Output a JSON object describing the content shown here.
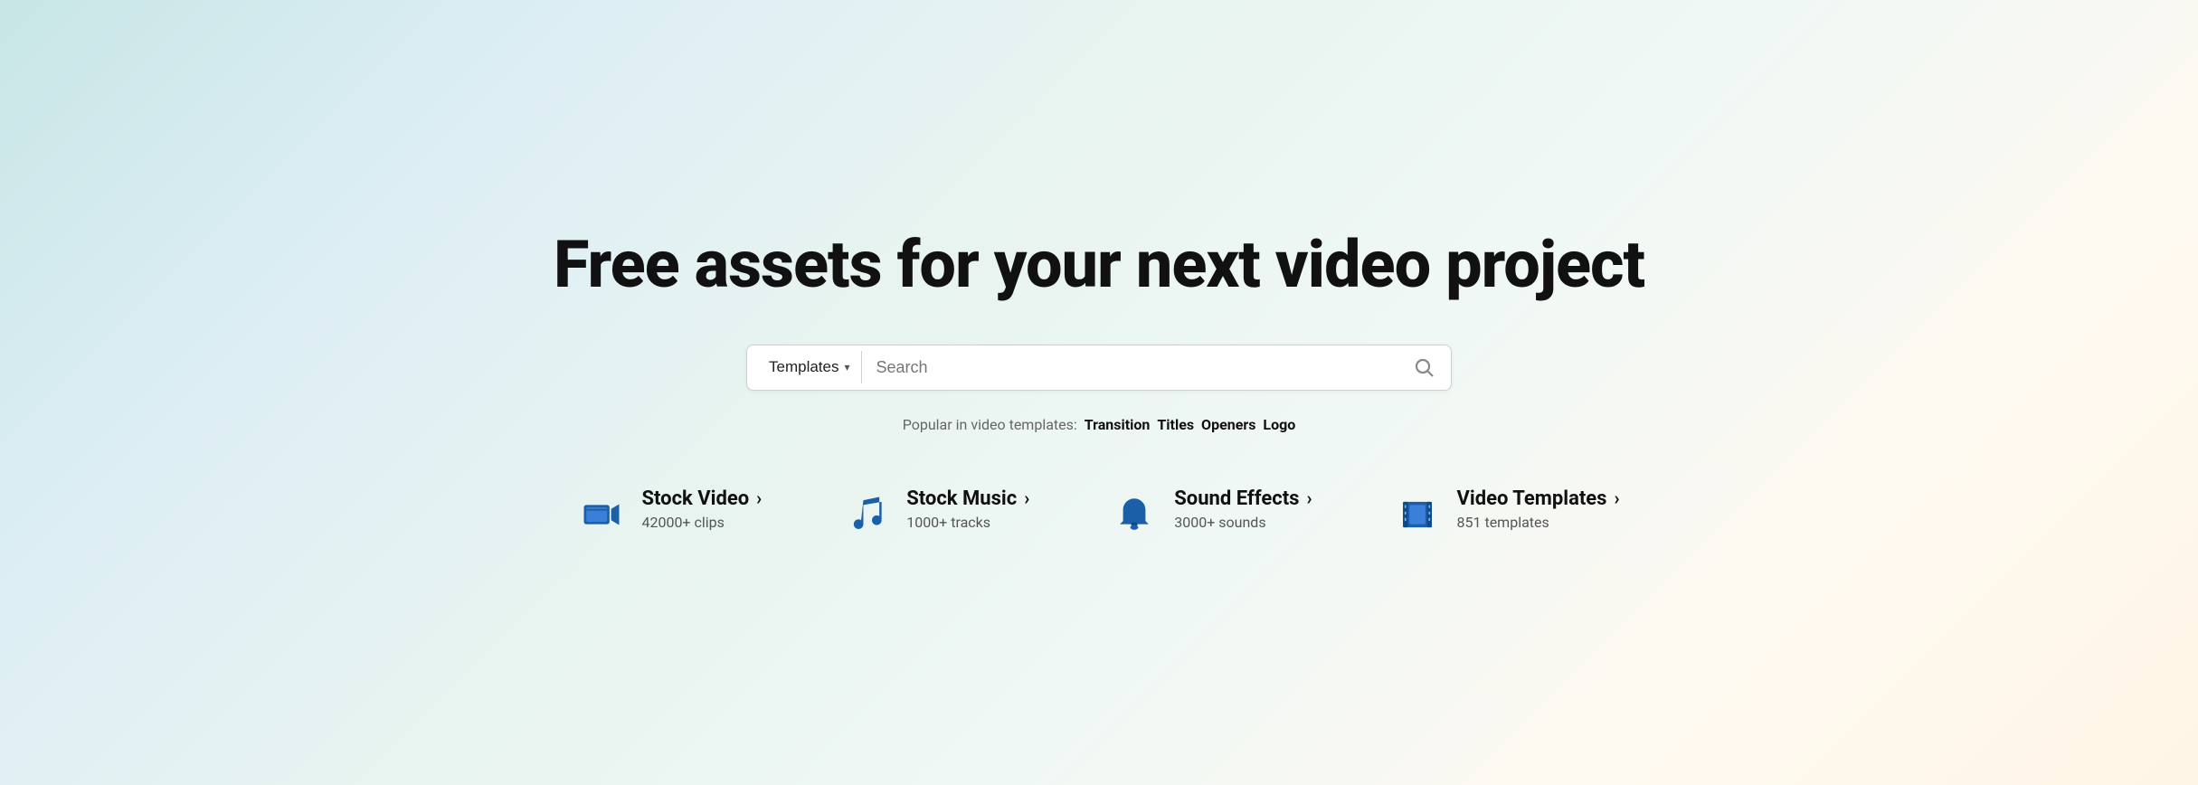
{
  "hero": {
    "title": "Free assets for your next video project"
  },
  "search": {
    "dropdown_label": "Templates",
    "placeholder": "Search",
    "button_label": "Search"
  },
  "popular": {
    "label": "Popular in video templates:",
    "tags": [
      "Transition",
      "Titles",
      "Openers",
      "Logo"
    ]
  },
  "categories": [
    {
      "id": "stock-video",
      "title": "Stock Video",
      "subtitle": "42000+ clips",
      "icon": "video-camera-icon",
      "arrow": "›"
    },
    {
      "id": "stock-music",
      "title": "Stock Music",
      "subtitle": "1000+ tracks",
      "icon": "music-note-icon",
      "arrow": "›"
    },
    {
      "id": "sound-effects",
      "title": "Sound Effects",
      "subtitle": "3000+ sounds",
      "icon": "bell-icon",
      "arrow": "›"
    },
    {
      "id": "video-templates",
      "title": "Video Templates",
      "subtitle": "851 templates",
      "icon": "film-strip-icon",
      "arrow": "›"
    }
  ]
}
